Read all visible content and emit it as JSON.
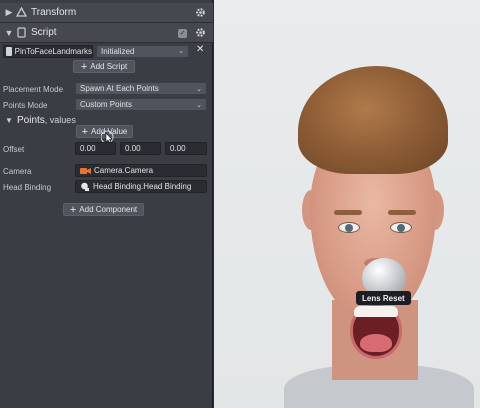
{
  "inspector": {
    "transform": {
      "title": "Transform"
    },
    "script": {
      "title": "Script",
      "asset_name": "PinToFaceLandmarks",
      "state": "Initialized",
      "add_script_label": "Add Script"
    },
    "fields": {
      "placement_mode": {
        "label": "Placement Mode",
        "value": "Spawn At Each Points"
      },
      "points_mode": {
        "label": "Points Mode",
        "value": "Custom Points"
      },
      "points": {
        "title_bold": "Points",
        "title_rest": ", values",
        "add_value_label": "Add Value"
      },
      "offset": {
        "label": "Offset",
        "values": [
          "0.00",
          "0.00",
          "0.00"
        ]
      },
      "camera": {
        "label": "Camera",
        "value": "Camera.Camera"
      },
      "head_binding": {
        "label": "Head Binding",
        "value": "Head Binding.Head Binding"
      }
    },
    "add_component_label": "Add Component"
  },
  "preview": {
    "tooltip": "Lens Reset"
  },
  "colors": {
    "panel_bg": "#3a3d44",
    "header_bg": "#45484f",
    "field_bg": "#2a2c31",
    "camera_icon": "#e5743a"
  },
  "icons": [
    "chevron-right-icon",
    "transform-icon",
    "gear-icon",
    "chevron-down-icon",
    "script-icon",
    "checkbox-icon",
    "close-icon",
    "plus-icon",
    "camera-icon",
    "head-binding-icon",
    "cursor-icon"
  ]
}
